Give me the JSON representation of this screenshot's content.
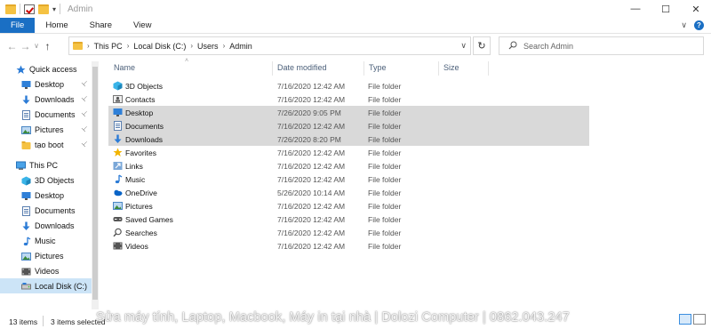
{
  "window": {
    "title": "Admin",
    "controls": [
      "minimize",
      "maximize",
      "close"
    ]
  },
  "ribbon": {
    "tabs": [
      "File",
      "Home",
      "Share",
      "View"
    ]
  },
  "address": {
    "segments": [
      "This PC",
      "Local Disk (C:)",
      "Users",
      "Admin"
    ],
    "search_placeholder": "Search Admin"
  },
  "nav": {
    "items": [
      {
        "label": "Quick access",
        "icon": "star-icon",
        "level": "top",
        "pinned": false,
        "selected": false
      },
      {
        "label": "Desktop",
        "icon": "desktop-icon",
        "level": "child",
        "pinned": true,
        "selected": false
      },
      {
        "label": "Downloads",
        "icon": "downloads-icon",
        "level": "child",
        "pinned": true,
        "selected": false
      },
      {
        "label": "Documents",
        "icon": "documents-icon",
        "level": "child",
        "pinned": true,
        "selected": false
      },
      {
        "label": "Pictures",
        "icon": "pictures-icon",
        "level": "child",
        "pinned": true,
        "selected": false
      },
      {
        "label": "tạo boot",
        "icon": "folder-icon",
        "level": "child",
        "pinned": true,
        "selected": false
      },
      {
        "label": "This PC",
        "icon": "pc-icon",
        "level": "top",
        "pinned": false,
        "selected": false
      },
      {
        "label": "3D Objects",
        "icon": "3d-objects-icon",
        "level": "child",
        "pinned": false,
        "selected": false
      },
      {
        "label": "Desktop",
        "icon": "desktop-icon",
        "level": "child",
        "pinned": false,
        "selected": false
      },
      {
        "label": "Documents",
        "icon": "documents-icon",
        "level": "child",
        "pinned": false,
        "selected": false
      },
      {
        "label": "Downloads",
        "icon": "downloads-icon",
        "level": "child",
        "pinned": false,
        "selected": false
      },
      {
        "label": "Music",
        "icon": "music-icon",
        "level": "child",
        "pinned": false,
        "selected": false
      },
      {
        "label": "Pictures",
        "icon": "pictures-icon",
        "level": "child",
        "pinned": false,
        "selected": false
      },
      {
        "label": "Videos",
        "icon": "videos-icon",
        "level": "child",
        "pinned": false,
        "selected": false
      },
      {
        "label": "Local Disk (C:)",
        "icon": "disk-icon",
        "level": "child",
        "pinned": false,
        "selected": true
      }
    ]
  },
  "columns": {
    "name": "Name",
    "date": "Date modified",
    "type": "Type",
    "size": "Size"
  },
  "files": [
    {
      "name": "3D Objects",
      "date": "7/16/2020 12:42 AM",
      "type": "File folder",
      "icon": "3d-objects-icon",
      "selected": false
    },
    {
      "name": "Contacts",
      "date": "7/16/2020 12:42 AM",
      "type": "File folder",
      "icon": "contacts-icon",
      "selected": false
    },
    {
      "name": "Desktop",
      "date": "7/26/2020 9:05 PM",
      "type": "File folder",
      "icon": "desktop-icon",
      "selected": true
    },
    {
      "name": "Documents",
      "date": "7/16/2020 12:42 AM",
      "type": "File folder",
      "icon": "documents-icon",
      "selected": true
    },
    {
      "name": "Downloads",
      "date": "7/26/2020 8:20 PM",
      "type": "File folder",
      "icon": "downloads-icon",
      "selected": true
    },
    {
      "name": "Favorites",
      "date": "7/16/2020 12:42 AM",
      "type": "File folder",
      "icon": "favorites-icon",
      "selected": false
    },
    {
      "name": "Links",
      "date": "7/16/2020 12:42 AM",
      "type": "File folder",
      "icon": "links-icon",
      "selected": false
    },
    {
      "name": "Music",
      "date": "7/16/2020 12:42 AM",
      "type": "File folder",
      "icon": "music-icon",
      "selected": false
    },
    {
      "name": "OneDrive",
      "date": "5/26/2020 10:14 AM",
      "type": "File folder",
      "icon": "onedrive-icon",
      "selected": false
    },
    {
      "name": "Pictures",
      "date": "7/16/2020 12:42 AM",
      "type": "File folder",
      "icon": "pictures-icon",
      "selected": false
    },
    {
      "name": "Saved Games",
      "date": "7/16/2020 12:42 AM",
      "type": "File folder",
      "icon": "saved-games-icon",
      "selected": false
    },
    {
      "name": "Searches",
      "date": "7/16/2020 12:42 AM",
      "type": "File folder",
      "icon": "searches-icon",
      "selected": false
    },
    {
      "name": "Videos",
      "date": "7/16/2020 12:42 AM",
      "type": "File folder",
      "icon": "videos-icon",
      "selected": false
    }
  ],
  "status": {
    "item_count": "13 items",
    "selected_count": "3 items selected"
  },
  "watermark": "Sửa máy tính, Laptop, Macbook, Máy in tại nhà | Dolozi Computer | 0862.043.247",
  "colors": {
    "accent": "#1a6fc4",
    "selection": "#d9d9d9",
    "nav_selection": "#cce4f7",
    "folder": "#f5c242"
  }
}
